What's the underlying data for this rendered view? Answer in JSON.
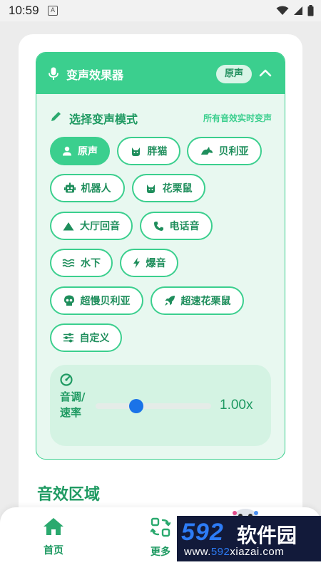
{
  "status_bar": {
    "time": "10:59",
    "notification_glyph": "A",
    "icons": [
      "wifi-icon",
      "signal-icon",
      "battery-icon"
    ]
  },
  "panel": {
    "title": "变声效果器",
    "current_badge": "原声",
    "section_title": "选择变声模式",
    "section_hint": "所有音效实时变声",
    "modes": [
      {
        "label": "原声",
        "icon": "person-icon",
        "active": true
      },
      {
        "label": "胖猫",
        "icon": "cat-icon",
        "active": false
      },
      {
        "label": "贝利亚",
        "icon": "dragon-icon",
        "active": false
      },
      {
        "label": "机器人",
        "icon": "robot-icon",
        "active": false
      },
      {
        "label": "花栗鼠",
        "icon": "cat-icon",
        "active": false
      },
      {
        "label": "大厅回音",
        "icon": "mountain-icon",
        "active": false
      },
      {
        "label": "电话音",
        "icon": "phone-icon",
        "active": false
      },
      {
        "label": "水下",
        "icon": "water-icon",
        "active": false
      },
      {
        "label": "爆音",
        "icon": "bolt-icon",
        "active": false
      },
      {
        "label": "超慢贝利亚",
        "icon": "skull-icon",
        "active": false
      },
      {
        "label": "超速花栗鼠",
        "icon": "rocket-icon",
        "active": false
      },
      {
        "label": "自定义",
        "icon": "sliders-icon",
        "active": false
      }
    ],
    "pitch": {
      "label": "音调/速率",
      "value_text": "1.00x",
      "slider_fraction": 0.35
    }
  },
  "sound_area_title": "音效区域",
  "bottom_nav": {
    "items": [
      {
        "label": "首页",
        "icon": "home-icon"
      },
      {
        "label": "更多",
        "icon": "more-icon"
      }
    ]
  },
  "watermark": {
    "logo_number": "592",
    "logo_text": "软件园",
    "url_prefix": "www.",
    "url_number": "592",
    "url_suffix": "xiazai.com"
  },
  "colors": {
    "accent": "#3bcf8e",
    "accent_dark": "#1f9a62",
    "panel_bg": "#e8f8f0",
    "slider_thumb": "#1a73e8"
  }
}
